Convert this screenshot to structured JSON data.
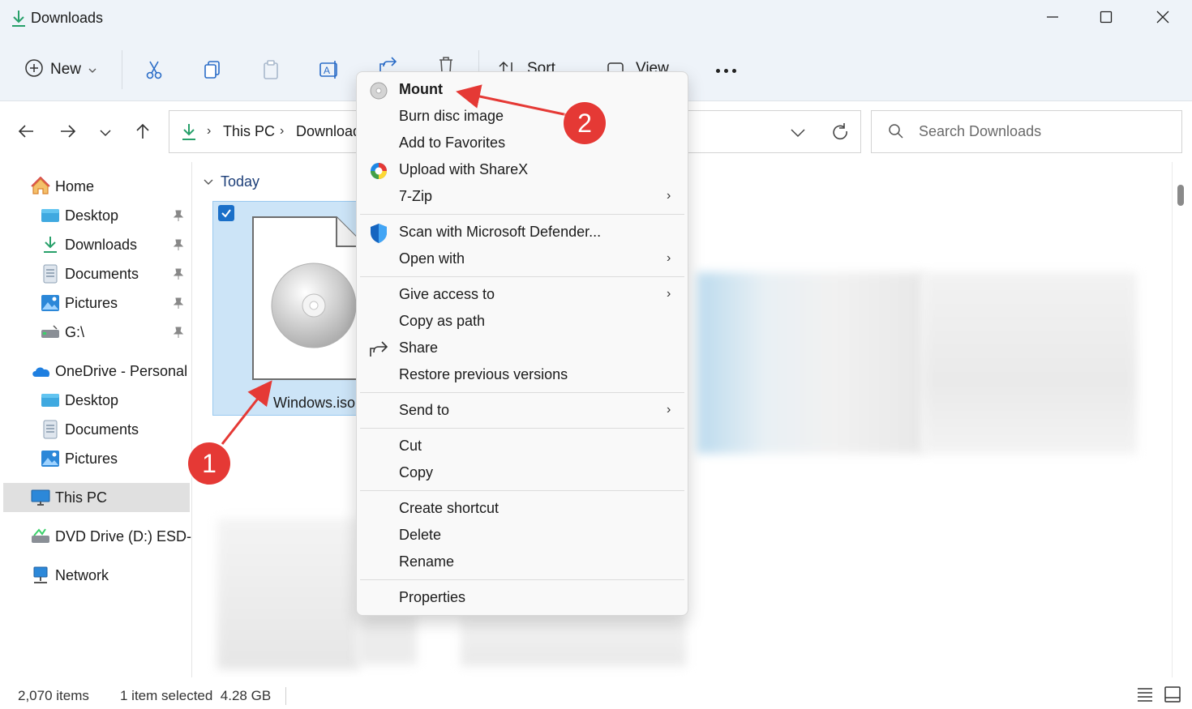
{
  "window": {
    "title": "Downloads",
    "title_icon": "download-arrow-icon",
    "controls": [
      "minimize-icon",
      "maximize-icon",
      "close-icon"
    ]
  },
  "command_bar": {
    "new_label": "New",
    "new_icon": "plus-circle-icon",
    "actions": [
      "cut-icon",
      "copy-icon",
      "paste-icon",
      "rename-icon",
      "share-icon",
      "delete-icon"
    ],
    "sort_label": "Sort",
    "view_label": "View",
    "more_icon": "ellipsis-icon"
  },
  "address": {
    "breadcrumbs": [
      "This PC",
      "Downloads"
    ],
    "search_placeholder": "Search Downloads"
  },
  "sidebar": {
    "items": [
      {
        "label": "Home",
        "icon": "home-icon"
      },
      {
        "label": "Desktop",
        "icon": "desktop-folder-icon",
        "pinned": true
      },
      {
        "label": "Downloads",
        "icon": "downloads-folder-icon",
        "pinned": true
      },
      {
        "label": "Documents",
        "icon": "documents-folder-icon",
        "pinned": true
      },
      {
        "label": "Pictures",
        "icon": "pictures-folder-icon",
        "pinned": true
      },
      {
        "label": "G:\\",
        "icon": "drive-icon",
        "pinned": true
      },
      {
        "label": "OneDrive - Personal",
        "icon": "onedrive-cloud-icon"
      },
      {
        "label": "Desktop",
        "icon": "desktop-folder-icon"
      },
      {
        "label": "Documents",
        "icon": "documents-folder-icon"
      },
      {
        "label": "Pictures",
        "icon": "pictures-folder-icon"
      },
      {
        "label": "This PC",
        "icon": "computer-icon",
        "selected": true
      },
      {
        "label": "DVD Drive (D:) ESD-ISO",
        "icon": "dvd-drive-icon"
      },
      {
        "label": "Network",
        "icon": "network-icon"
      }
    ]
  },
  "content": {
    "group_header": "Today",
    "file": {
      "name": "Windows.iso",
      "icon": "disc-image-icon",
      "selected": true
    }
  },
  "context_menu": {
    "items": [
      {
        "label": "Mount",
        "icon": "disc-icon",
        "bold": true
      },
      {
        "label": "Burn disc image"
      },
      {
        "label": "Add to Favorites"
      },
      {
        "label": "Upload with ShareX",
        "icon": "sharex-icon"
      },
      {
        "label": "7-Zip",
        "submenu": true
      },
      {
        "label": "Scan with Microsoft Defender...",
        "icon": "defender-shield-icon"
      },
      {
        "label": "Open with",
        "submenu": true
      },
      {
        "label": "Give access to",
        "submenu": true
      },
      {
        "label": "Copy as path"
      },
      {
        "label": "Share",
        "icon": "share-icon"
      },
      {
        "label": "Restore previous versions"
      },
      {
        "label": "Send to",
        "submenu": true
      },
      {
        "label": "Cut"
      },
      {
        "label": "Copy"
      },
      {
        "label": "Create shortcut"
      },
      {
        "label": "Delete"
      },
      {
        "label": "Rename"
      },
      {
        "label": "Properties"
      }
    ]
  },
  "status_bar": {
    "item_count": "2,070 items",
    "selection": "1 item selected  4.28 GB"
  },
  "annotations": {
    "callout_1": "1",
    "callout_2": "2",
    "color": "#e53935"
  },
  "colors": {
    "accent": "#1a6fc8",
    "selection_bg": "#cce4f7",
    "chrome_bg": "#eef3f9"
  }
}
